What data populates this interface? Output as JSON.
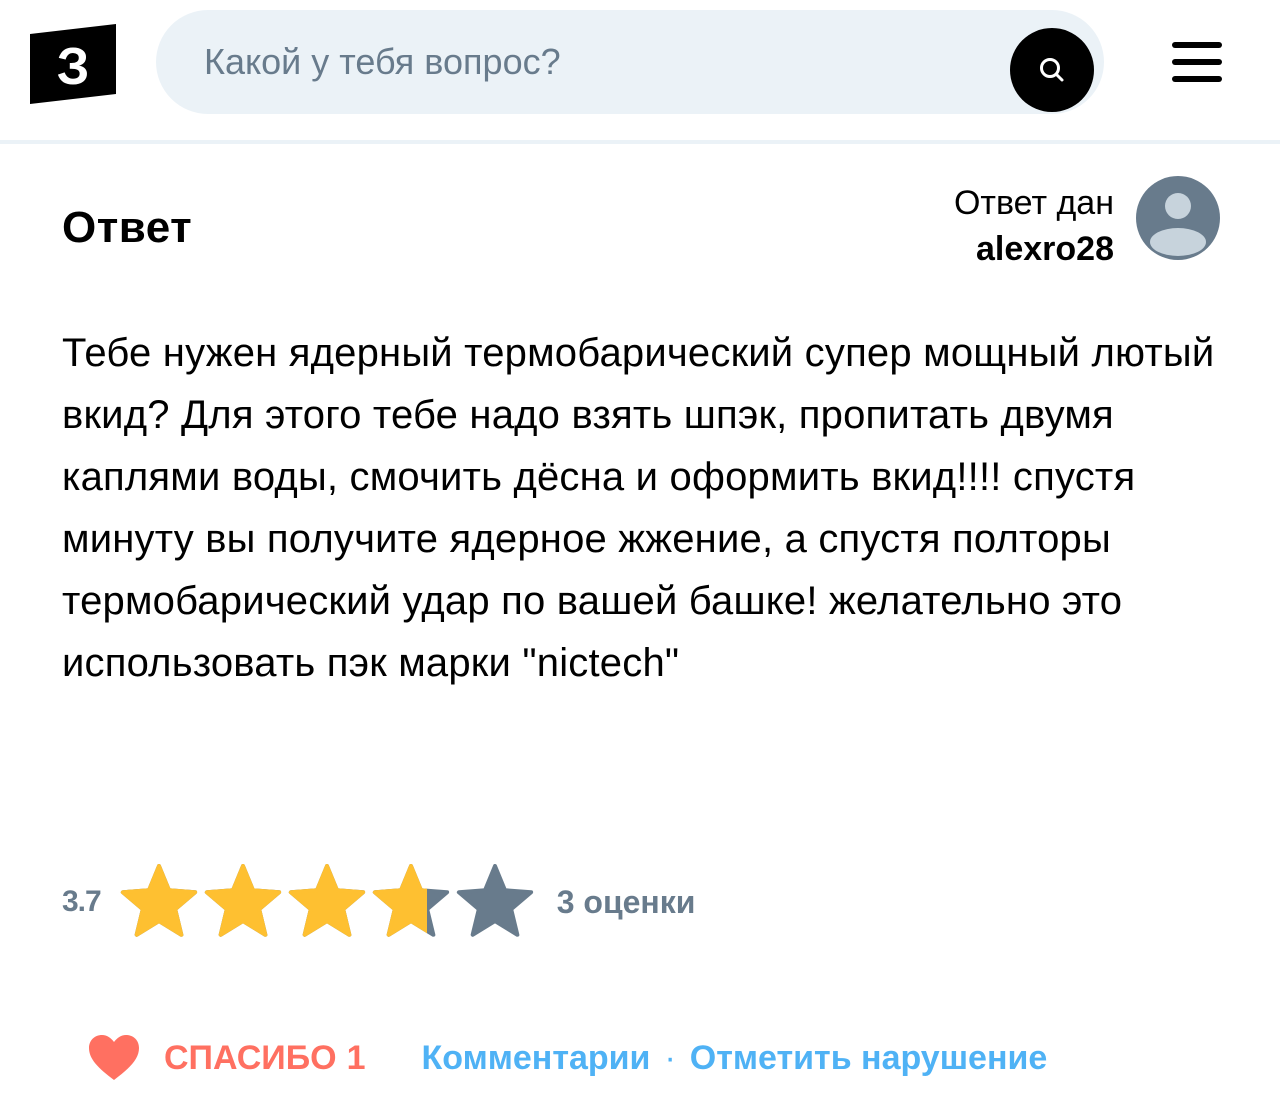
{
  "header": {
    "logo_letter": "З",
    "search": {
      "placeholder": "Какой у тебя вопрос?",
      "button_icon": "search-icon"
    },
    "menu_icon": "hamburger-menu-icon"
  },
  "answer": {
    "title": "Ответ",
    "author_caption": "Ответ дан",
    "author_name": "alexro28",
    "avatar_icon": "user-avatar-icon",
    "text": "Тебе нужен ядерный термобарический супер мощный лютый вкид? Для этого тебе надо взять шпэк, пропитать двумя каплями воды, смочить дёсна и оформить вкид!!!! спустя минуту вы получите ядерное жжение, а спустя полторы термобарический удар по вашей башке! желательно это использовать пэк марки \"nictech\""
  },
  "rating": {
    "value": "3.7",
    "score": 3.7,
    "max": 5,
    "count_label": "3 оценки",
    "star_icon": "star-icon"
  },
  "actions": {
    "thanks_label": "СПАСИБО",
    "thanks_count": "1",
    "heart_icon": "heart-icon",
    "comments_label": "Комментарии",
    "separator": "·",
    "report_label": "Отметить нарушение"
  },
  "colors": {
    "search_bg": "#ebf2f7",
    "placeholder": "#687b8c",
    "star_filled": "#fec031",
    "star_empty": "#687b8c",
    "thanks": "#ff7061",
    "link": "#4fb2f5",
    "avatar": "#687b8c"
  }
}
